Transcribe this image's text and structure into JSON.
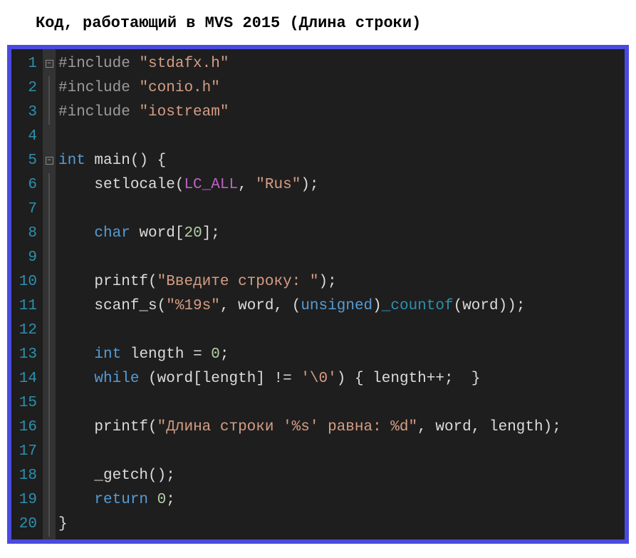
{
  "title": "Код, работающий в MVS 2015 (Длина строки)",
  "lineNumbers": [
    "1",
    "2",
    "3",
    "4",
    "5",
    "6",
    "7",
    "8",
    "9",
    "10",
    "11",
    "12",
    "13",
    "14",
    "15",
    "16",
    "17",
    "18",
    "19",
    "20"
  ],
  "fold": {
    "box1Line": 1,
    "box2Line": 5,
    "symbol": "−"
  },
  "code": [
    [
      {
        "cls": "tok-pp",
        "t": "#include"
      },
      {
        "cls": "",
        "t": " "
      },
      {
        "cls": "tok-str",
        "t": "\"stdafx.h\""
      }
    ],
    [
      {
        "cls": "tok-pp",
        "t": "#include"
      },
      {
        "cls": "",
        "t": " "
      },
      {
        "cls": "tok-str",
        "t": "\"conio.h\""
      }
    ],
    [
      {
        "cls": "tok-pp",
        "t": "#include"
      },
      {
        "cls": "",
        "t": " "
      },
      {
        "cls": "tok-str",
        "t": "\"iostream\""
      }
    ],
    [],
    [
      {
        "cls": "tok-kw",
        "t": "int"
      },
      {
        "cls": "",
        "t": " "
      },
      {
        "cls": "tok-fn",
        "t": "main"
      },
      {
        "cls": "tok-paren",
        "t": "() {"
      }
    ],
    [
      {
        "cls": "",
        "t": "    "
      },
      {
        "cls": "tok-fn",
        "t": "setlocale"
      },
      {
        "cls": "tok-paren",
        "t": "("
      },
      {
        "cls": "tok-macro",
        "t": "LC_ALL"
      },
      {
        "cls": "tok-op",
        "t": ", "
      },
      {
        "cls": "tok-str",
        "t": "\"Rus\""
      },
      {
        "cls": "tok-paren",
        "t": ");"
      }
    ],
    [],
    [
      {
        "cls": "",
        "t": "    "
      },
      {
        "cls": "tok-kw",
        "t": "char"
      },
      {
        "cls": "",
        "t": " "
      },
      {
        "cls": "tok-id",
        "t": "word"
      },
      {
        "cls": "tok-op",
        "t": "["
      },
      {
        "cls": "tok-num",
        "t": "20"
      },
      {
        "cls": "tok-op",
        "t": "];"
      }
    ],
    [],
    [
      {
        "cls": "",
        "t": "    "
      },
      {
        "cls": "tok-fn",
        "t": "printf"
      },
      {
        "cls": "tok-paren",
        "t": "("
      },
      {
        "cls": "tok-str",
        "t": "\"Введите строку: \""
      },
      {
        "cls": "tok-paren",
        "t": ");"
      }
    ],
    [
      {
        "cls": "",
        "t": "    "
      },
      {
        "cls": "tok-fn",
        "t": "scanf_s"
      },
      {
        "cls": "tok-paren",
        "t": "("
      },
      {
        "cls": "tok-str",
        "t": "\"%19s\""
      },
      {
        "cls": "tok-op",
        "t": ", "
      },
      {
        "cls": "tok-id",
        "t": "word"
      },
      {
        "cls": "tok-op",
        "t": ", ("
      },
      {
        "cls": "tok-kw",
        "t": "unsigned"
      },
      {
        "cls": "tok-op",
        "t": ")"
      },
      {
        "cls": "tok-countof",
        "t": "_countof"
      },
      {
        "cls": "tok-paren",
        "t": "("
      },
      {
        "cls": "tok-id",
        "t": "word"
      },
      {
        "cls": "tok-paren",
        "t": "));"
      }
    ],
    [],
    [
      {
        "cls": "",
        "t": "    "
      },
      {
        "cls": "tok-kw",
        "t": "int"
      },
      {
        "cls": "",
        "t": " "
      },
      {
        "cls": "tok-id",
        "t": "length"
      },
      {
        "cls": "tok-op",
        "t": " = "
      },
      {
        "cls": "tok-num",
        "t": "0"
      },
      {
        "cls": "tok-op",
        "t": ";"
      }
    ],
    [
      {
        "cls": "",
        "t": "    "
      },
      {
        "cls": "tok-kw",
        "t": "while"
      },
      {
        "cls": "",
        "t": " "
      },
      {
        "cls": "tok-paren",
        "t": "("
      },
      {
        "cls": "tok-id",
        "t": "word"
      },
      {
        "cls": "tok-op",
        "t": "["
      },
      {
        "cls": "tok-id",
        "t": "length"
      },
      {
        "cls": "tok-op",
        "t": "] != "
      },
      {
        "cls": "tok-str",
        "t": "'\\0'"
      },
      {
        "cls": "tok-paren",
        "t": ") { "
      },
      {
        "cls": "tok-id",
        "t": "length"
      },
      {
        "cls": "tok-op",
        "t": "++;  "
      },
      {
        "cls": "tok-paren",
        "t": "}"
      }
    ],
    [],
    [
      {
        "cls": "",
        "t": "    "
      },
      {
        "cls": "tok-fn",
        "t": "printf"
      },
      {
        "cls": "tok-paren",
        "t": "("
      },
      {
        "cls": "tok-str",
        "t": "\"Длина строки '%s' равна: %d\""
      },
      {
        "cls": "tok-op",
        "t": ", "
      },
      {
        "cls": "tok-id",
        "t": "word"
      },
      {
        "cls": "tok-op",
        "t": ", "
      },
      {
        "cls": "tok-id",
        "t": "length"
      },
      {
        "cls": "tok-paren",
        "t": ");"
      }
    ],
    [],
    [
      {
        "cls": "",
        "t": "    "
      },
      {
        "cls": "tok-fn",
        "t": "_getch"
      },
      {
        "cls": "tok-paren",
        "t": "();"
      }
    ],
    [
      {
        "cls": "",
        "t": "    "
      },
      {
        "cls": "tok-kw",
        "t": "return"
      },
      {
        "cls": "",
        "t": " "
      },
      {
        "cls": "tok-num",
        "t": "0"
      },
      {
        "cls": "tok-op",
        "t": ";"
      }
    ],
    [
      {
        "cls": "tok-paren",
        "t": "}"
      }
    ]
  ]
}
